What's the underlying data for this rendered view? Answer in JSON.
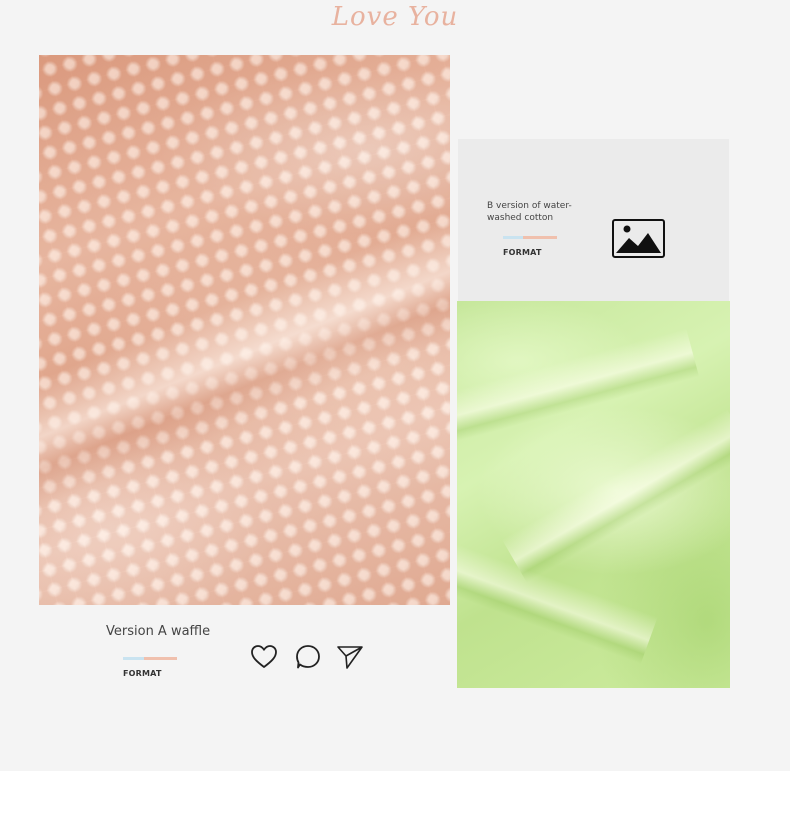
{
  "header": {
    "script_title": "Love You"
  },
  "product_a": {
    "caption": "Version A waffle",
    "format_label": "FORMAT",
    "swatch_color": "#f0c0ad"
  },
  "actions": [
    {
      "icon": "heart-icon"
    },
    {
      "icon": "comment-icon"
    },
    {
      "icon": "send-icon"
    }
  ],
  "product_b": {
    "caption": "B version of water-washed cotton",
    "format_label": "FORMAT",
    "icon": "image-icon",
    "swatch_color": "#c6e79b"
  },
  "colors": {
    "accent_peach": "#f0c0ad",
    "accent_blue": "#c9e3f0",
    "background": "#f4f4f4"
  }
}
